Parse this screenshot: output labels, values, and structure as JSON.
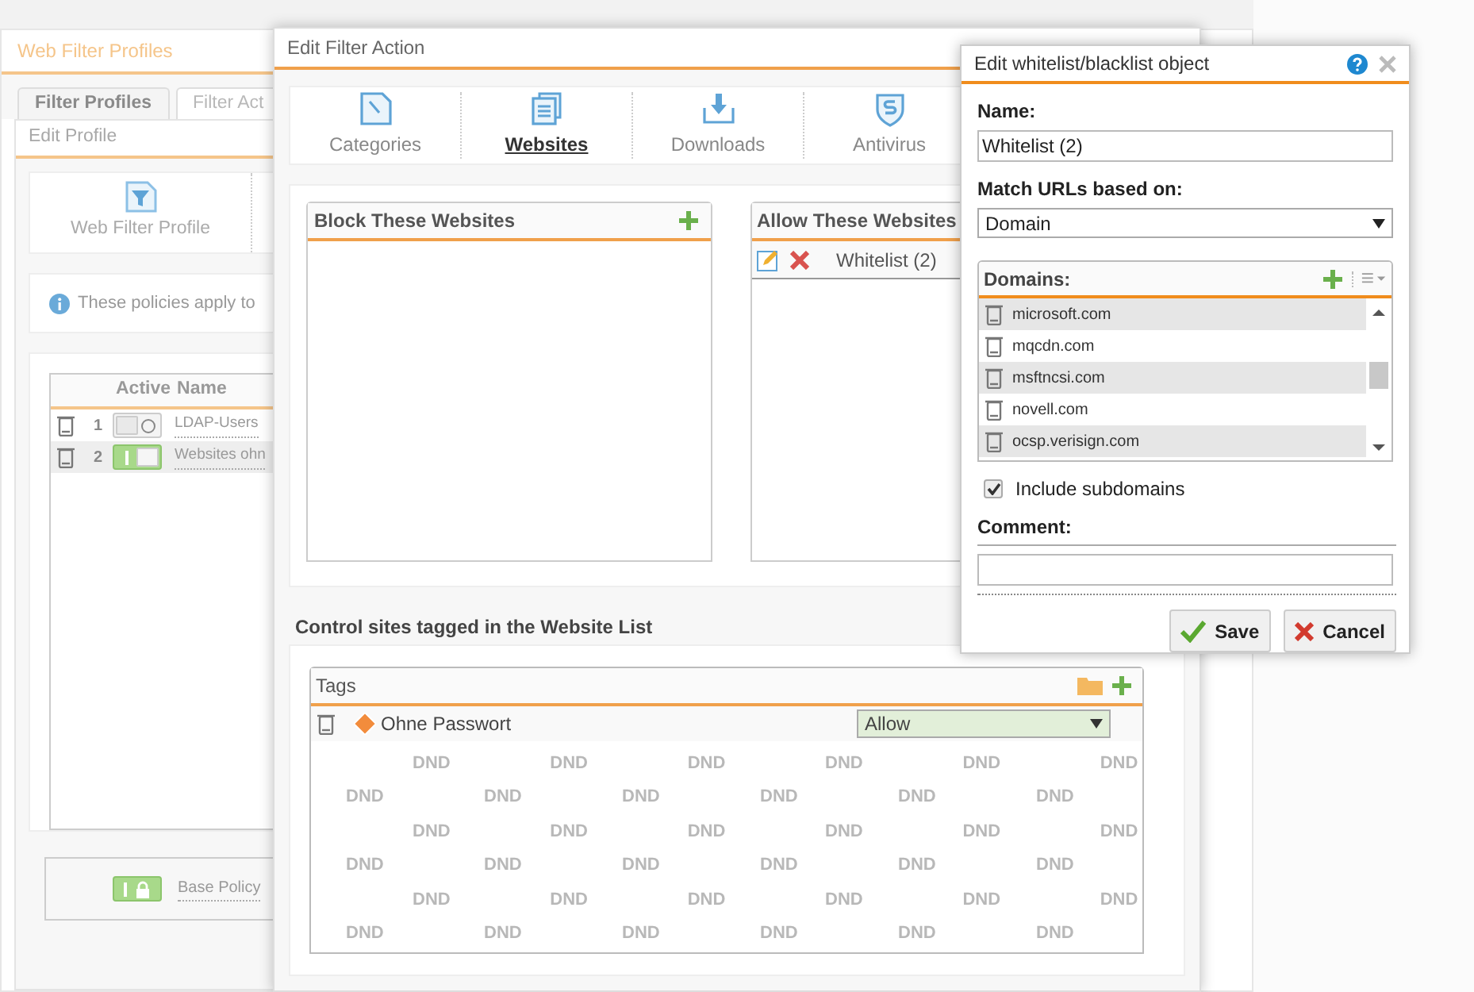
{
  "background_window": {
    "title": "Web Filter Profiles",
    "tabs": [
      {
        "label": "Filter Profiles",
        "selected": true
      },
      {
        "label": "Filter Act",
        "selected": false
      }
    ],
    "edit_profile": {
      "title": "Edit Profile",
      "tab_label": "Web Filter Profile",
      "info": "These policies apply to",
      "table": {
        "columns": [
          "Active",
          "Name"
        ],
        "rows": [
          {
            "index": "1",
            "on": false,
            "name": "LDAP-Users",
            "selected": false
          },
          {
            "index": "2",
            "on": true,
            "name": "Websites ohn",
            "selected": true
          }
        ]
      },
      "base_policy": {
        "on": true,
        "name": "Base Policy"
      }
    }
  },
  "filter_action": {
    "title": "Edit Filter Action",
    "tabs": [
      {
        "label": "Categories",
        "kind": "categories",
        "selected": false
      },
      {
        "label": "Websites",
        "kind": "websites",
        "selected": true
      },
      {
        "label": "Downloads",
        "kind": "downloads",
        "selected": false
      },
      {
        "label": "Antivirus",
        "kind": "antivirus",
        "selected": false
      }
    ],
    "block_panel": {
      "title": "Block These Websites"
    },
    "allow_panel": {
      "title": "Allow These Websites",
      "items": [
        "Whitelist (2)"
      ]
    },
    "tags_section": {
      "heading": "Control sites tagged in the Website List",
      "title": "Tags",
      "rows": [
        {
          "name": "Ohne Passwort",
          "action": "Allow"
        }
      ],
      "dnd_marks": [
        "DND",
        "DND",
        "DND",
        "DND",
        "DND",
        "DND",
        "DND",
        "DND",
        "DND",
        "DND",
        "DND",
        "DND",
        "DND",
        "DND",
        "DND",
        "DND",
        "DND",
        "DND",
        "DND",
        "DND",
        "DND",
        "DND",
        "DND",
        "DND",
        "DND",
        "DND",
        "DND",
        "DND",
        "DND",
        "DND",
        "DND",
        "DND",
        "DND",
        "DND",
        "DND",
        "DND"
      ]
    }
  },
  "dialog": {
    "title": "Edit whitelist/blacklist object",
    "name_label": "Name:",
    "name_value": "Whitelist (2)",
    "match_label": "Match URLs based on:",
    "match_value": "Domain",
    "domains_label": "Domains:",
    "domains": [
      "microsoft.com",
      "mqcdn.com",
      "msftncsi.com",
      "novell.com",
      "ocsp.verisign.com"
    ],
    "include_subdomains": {
      "label": "Include subdomains",
      "checked": true
    },
    "comment_label": "Comment:",
    "buttons": [
      {
        "label": "Save",
        "kind": "save"
      },
      {
        "label": "Cancel",
        "kind": "cancel"
      }
    ]
  }
}
